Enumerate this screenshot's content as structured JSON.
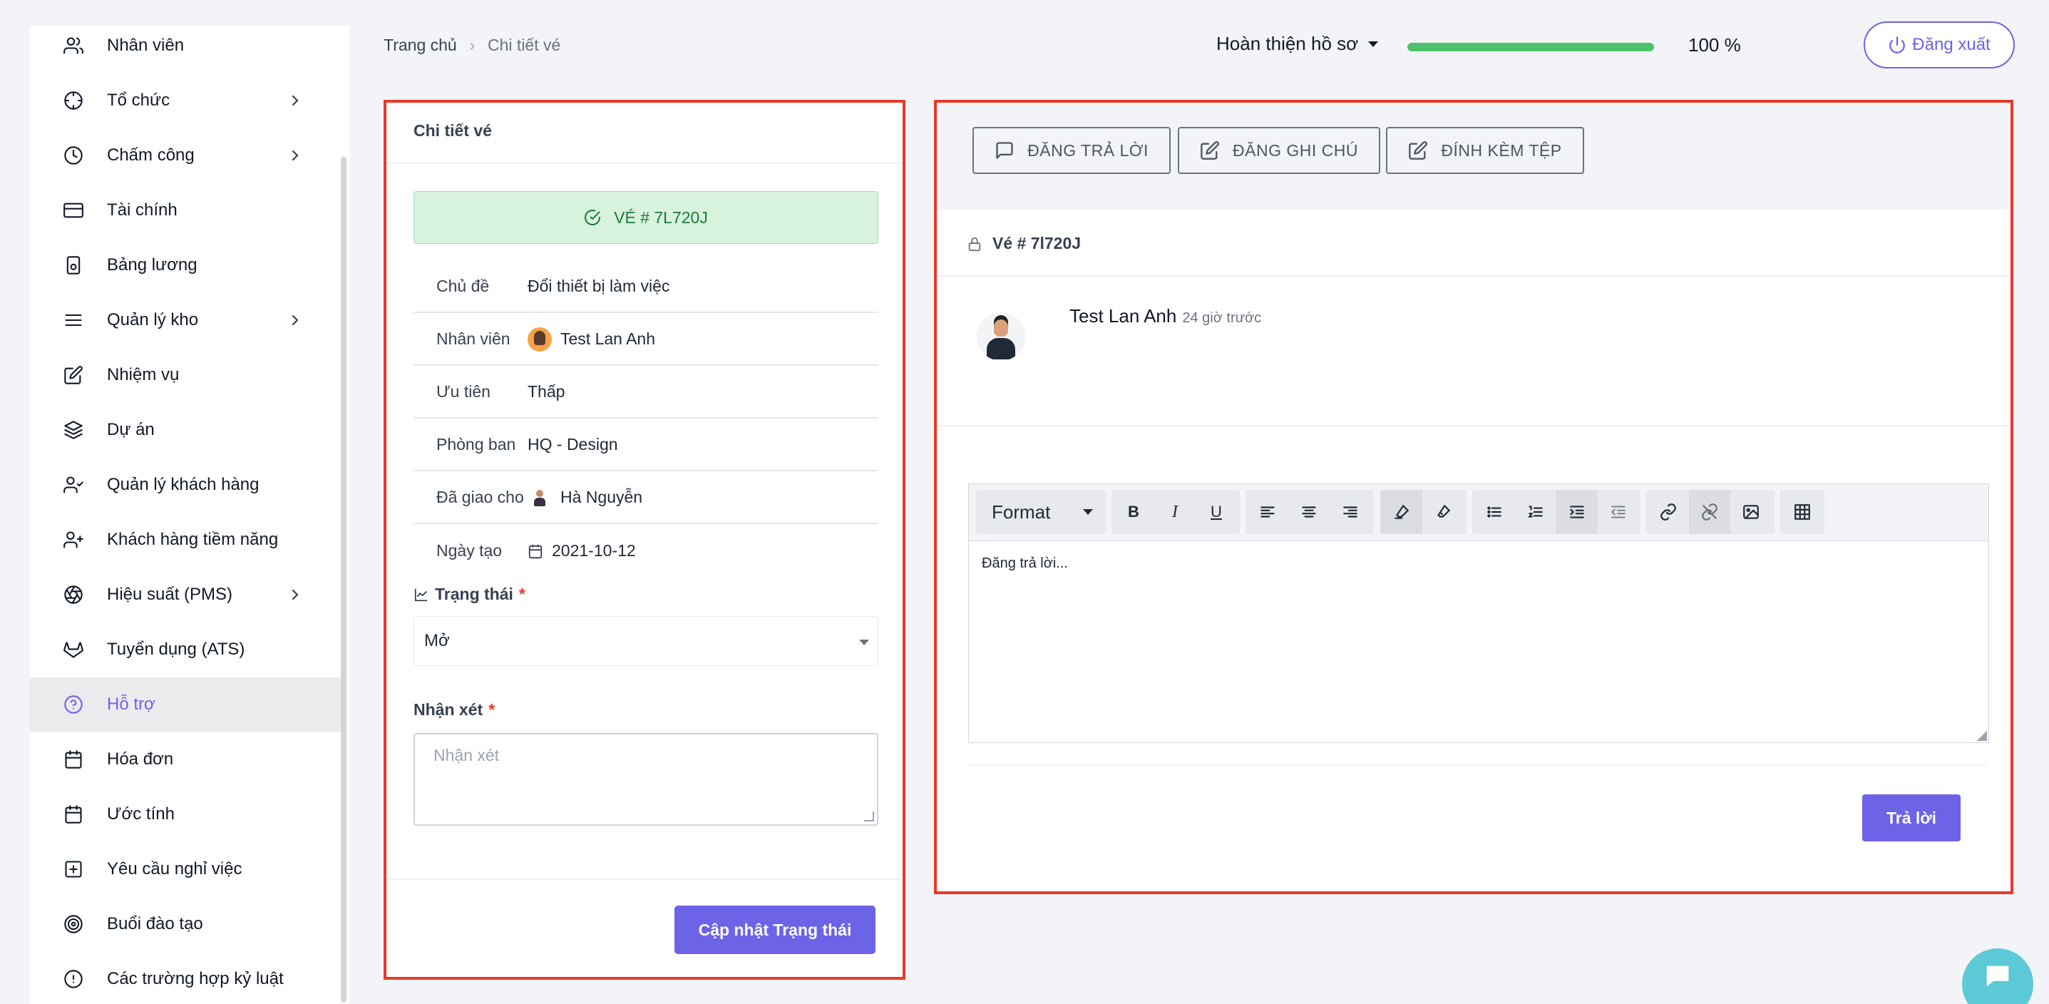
{
  "sidebar": {
    "items": [
      {
        "label": "Nhân viên",
        "icon": "users-icon",
        "has_children": false,
        "active": false
      },
      {
        "label": "Tổ chức",
        "icon": "crosshair-icon",
        "has_children": true,
        "active": false
      },
      {
        "label": "Chấm công",
        "icon": "clock-icon",
        "has_children": true,
        "active": false
      },
      {
        "label": "Tài chính",
        "icon": "credit-card-icon",
        "has_children": false,
        "active": false
      },
      {
        "label": "Bảng lương",
        "icon": "payslip-icon",
        "has_children": false,
        "active": false
      },
      {
        "label": "Quản lý kho",
        "icon": "menu-icon",
        "has_children": true,
        "active": false
      },
      {
        "label": "Nhiệm vụ",
        "icon": "edit-icon",
        "has_children": false,
        "active": false
      },
      {
        "label": "Dự án",
        "icon": "layers-icon",
        "has_children": false,
        "active": false
      },
      {
        "label": "Quản lý khách hàng",
        "icon": "user-check-icon",
        "has_children": false,
        "active": false
      },
      {
        "label": "Khách hàng tiềm năng",
        "icon": "user-plus-icon",
        "has_children": false,
        "active": false
      },
      {
        "label": "Hiệu suất (PMS)",
        "icon": "aperture-icon",
        "has_children": true,
        "active": false
      },
      {
        "label": "Tuyển dụng (ATS)",
        "icon": "gitlab-icon",
        "has_children": false,
        "active": false
      },
      {
        "label": "Hỗ trợ",
        "icon": "help-circle-icon",
        "has_children": false,
        "active": true
      },
      {
        "label": "Hóa đơn",
        "icon": "calendar-icon",
        "has_children": false,
        "active": false
      },
      {
        "label": "Ước tính",
        "icon": "calendar-icon",
        "has_children": false,
        "active": false
      },
      {
        "label": "Yêu cầu nghỉ việc",
        "icon": "plus-square-icon",
        "has_children": false,
        "active": false
      },
      {
        "label": "Buổi đào tạo",
        "icon": "target-icon",
        "has_children": false,
        "active": false
      },
      {
        "label": "Các trường hợp kỷ luật",
        "icon": "alert-circle-icon",
        "has_children": false,
        "active": false
      }
    ]
  },
  "header": {
    "breadcrumb_home": "Trang chủ",
    "breadcrumb_sep": "›",
    "breadcrumb_current": "Chi tiết vé",
    "profile_label": "Hoàn thiện hồ sơ",
    "profile_progress": 100,
    "profile_progress_text": "100 %",
    "logout_label": "Đăng xuất"
  },
  "ticket": {
    "panel_title": "Chi tiết vé",
    "badge": "VÉ # 7L720J",
    "rows": [
      {
        "label": "Chủ đề",
        "value": "Đổi thiết bị làm việc"
      },
      {
        "label": "Nhân viên",
        "value": "Test Lan Anh"
      },
      {
        "label": "Ưu tiên",
        "value": "Thấp"
      },
      {
        "label": "Phòng ban",
        "value": "HQ - Design"
      },
      {
        "label": "Đã giao cho",
        "value": "Hà Nguyễn"
      },
      {
        "label": "Ngày tạo",
        "value": "2021-10-12"
      }
    ],
    "status_label": "Trạng thái",
    "status_value": "Mở",
    "comment_label": "Nhận xét",
    "comment_placeholder": "Nhận xét",
    "required_mark": "*",
    "update_button": "Cập nhật Trạng thái"
  },
  "reply": {
    "actions": [
      "ĐĂNG TRẢ LỜI",
      "ĐĂNG GHI CHÚ",
      "ĐÍNH KÈM TỆP"
    ],
    "ticket_ref": "Vé # 7l720J",
    "author": "Test Lan Anh",
    "time": "24 giờ trước",
    "editor_format": "Format",
    "editor_text": "Đăng trả lời...",
    "submit": "Trả lời"
  },
  "colors": {
    "accent": "#6d63e6",
    "highlight_border": "#e53a2b",
    "progress": "#4cc36a",
    "badge_bg": "#d7f2dd"
  }
}
